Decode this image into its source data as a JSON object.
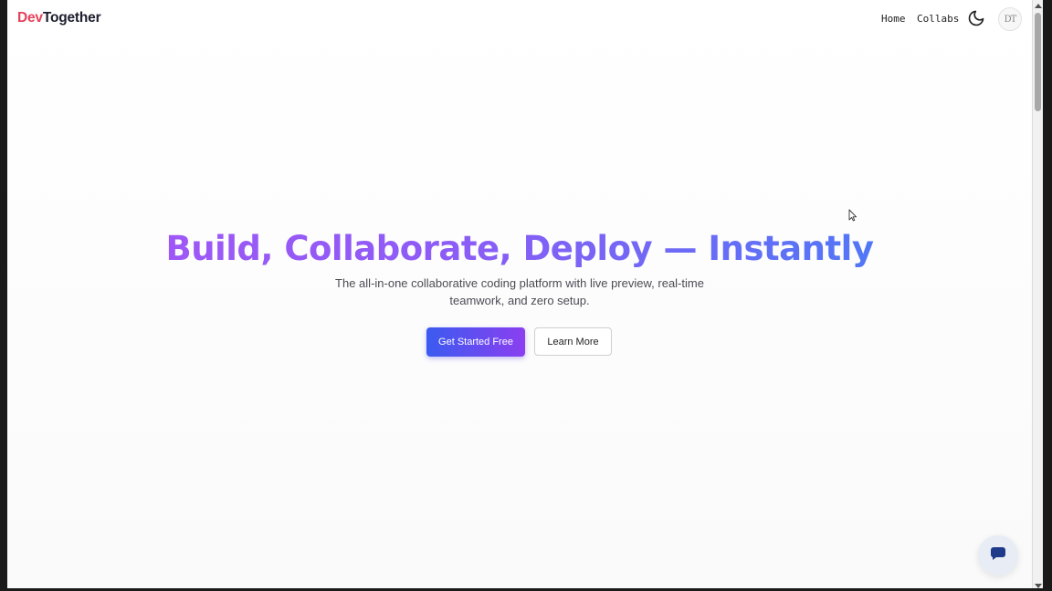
{
  "brand": {
    "prefix": "Dev",
    "suffix": "Together"
  },
  "nav": {
    "home": "Home",
    "collabs": "Collabs"
  },
  "avatar": {
    "initials": "DT"
  },
  "hero": {
    "title": "Build, Collaborate, Deploy — Instantly",
    "subtitle_line1": "The all-in-one collaborative coding platform with live preview, real-time",
    "subtitle_line2": "teamwork, and zero setup.",
    "cta_primary": "Get Started Free",
    "cta_secondary": "Learn More"
  },
  "colors": {
    "brand_accent": "#e4435a",
    "gradient_start": "#a855f7",
    "gradient_end": "#3b82f6",
    "button_gradient_start": "#3b5bf0",
    "button_gradient_end": "#8b3ff0"
  },
  "icons": {
    "theme_toggle": "moon-icon",
    "chat": "chat-bubble-icon",
    "cursor": "mouse-pointer-icon"
  }
}
